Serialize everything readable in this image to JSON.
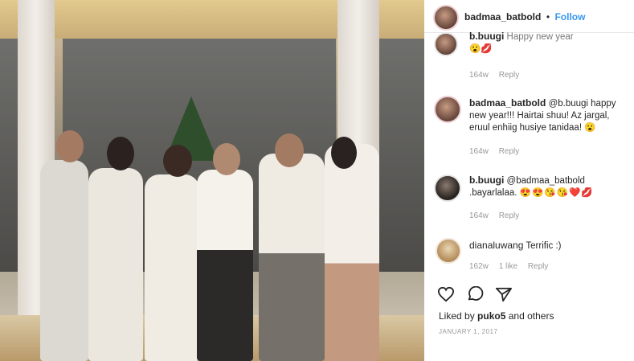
{
  "post": {
    "username": "badmaa_batbold",
    "follow_label": "Follow",
    "separator": "•",
    "comments": [
      {
        "username": "b.buugi",
        "text": "Happy new year",
        "emoji": "😮💋",
        "time": "164w",
        "reply_label": "Reply"
      },
      {
        "username": "badmaa_batbold",
        "text": "@b.buugi happy new year!!! Hairtai shuu! Az jargal, eruul enhiig husiye tanidaa!",
        "emoji": "😮",
        "time": "164w",
        "reply_label": "Reply"
      },
      {
        "username": "b.buugi",
        "text": "@badmaa_batbold .bayarlalaa.",
        "emoji": "😍😍😘😘❤️💋",
        "time": "164w",
        "reply_label": "Reply"
      },
      {
        "username": "dianaluwang",
        "text": "Terrific :)",
        "emoji": "",
        "time": "162w",
        "likes": "1 like",
        "reply_label": "Reply"
      }
    ],
    "actions": {
      "like_icon": "heart-icon",
      "comment_icon": "comment-icon",
      "share_icon": "share-icon"
    },
    "liked_prefix": "Liked by",
    "liked_user": "puko5",
    "liked_suffix": "and others",
    "date": "JANUARY 1, 2017"
  },
  "colors": {
    "link": "#3897f0",
    "text": "#262626",
    "muted": "#999999"
  }
}
